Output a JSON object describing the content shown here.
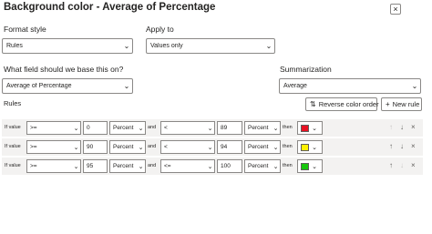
{
  "dialog": {
    "title": "Background color - Average of Percentage",
    "close_glyph": "×"
  },
  "format_style": {
    "label": "Format style",
    "value": "Rules"
  },
  "apply_to": {
    "label": "Apply to",
    "value": "Values only"
  },
  "base_field": {
    "label": "What field should we base this on?",
    "value": "Average of Percentage"
  },
  "summarization": {
    "label": "Summarization",
    "value": "Average"
  },
  "rules_section": {
    "label": "Rules",
    "reverse_button": "Reverse color order",
    "new_rule_button": "New rule"
  },
  "rules": [
    {
      "if_label": "If value",
      "op1": ">=",
      "val1": "0",
      "unit1": "Percent",
      "and_label": "and",
      "op2": "<",
      "val2": "89",
      "unit2": "Percent",
      "then_label": "then",
      "color": "#e81123"
    },
    {
      "if_label": "If value",
      "op1": ">=",
      "val1": "90",
      "unit1": "Percent",
      "and_label": "and",
      "op2": "<",
      "val2": "94",
      "unit2": "Percent",
      "then_label": "then",
      "color": "#fff100"
    },
    {
      "if_label": "If value",
      "op1": ">=",
      "val1": "95",
      "unit1": "Percent",
      "and_label": "and",
      "op2": "<=",
      "val2": "100",
      "unit2": "Percent",
      "then_label": "then",
      "color": "#16c60c"
    }
  ],
  "icons": {
    "chevron": "chevron-down-icon",
    "up": "arrow-up-icon",
    "down": "arrow-down-icon",
    "delete": "delete-icon",
    "reverse": "reverse-icon",
    "plus": "plus-icon"
  }
}
